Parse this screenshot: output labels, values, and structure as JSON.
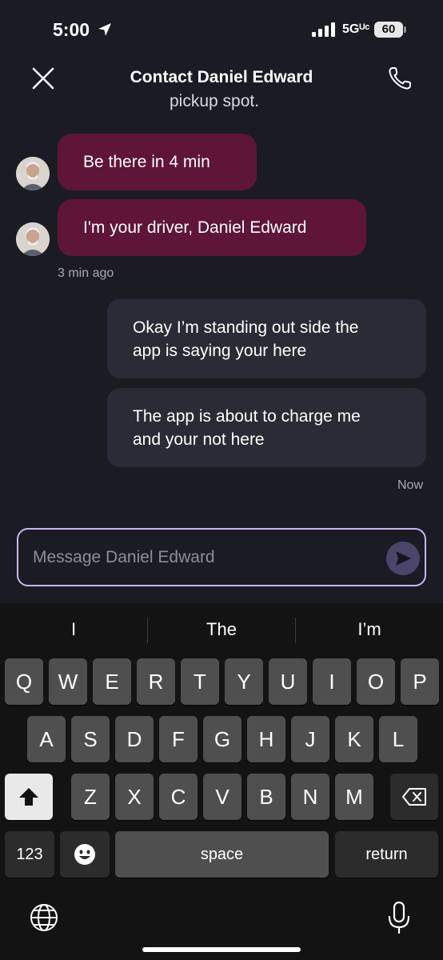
{
  "status_bar": {
    "time": "5:00",
    "network": "5Gᵁᶜ",
    "battery": "60"
  },
  "header": {
    "title": "Contact Daniel Edward"
  },
  "chat": {
    "partial_message": "pickup spot.",
    "incoming": [
      {
        "text": "Be there in 4 min"
      },
      {
        "text": "I'm your driver, Daniel Edward"
      }
    ],
    "incoming_timestamp": "3 min ago",
    "outgoing": [
      {
        "line1": "Okay I’m standing out side the",
        "line2": "app is saying your here"
      },
      {
        "line1": "The app is about to charge me",
        "line2": "and your not here"
      }
    ],
    "outgoing_timestamp": "Now"
  },
  "composer": {
    "placeholder": "Message Daniel Edward"
  },
  "keyboard": {
    "suggestions": [
      "I",
      "The",
      "I’m"
    ],
    "row1": [
      "Q",
      "W",
      "E",
      "R",
      "T",
      "Y",
      "U",
      "I",
      "O",
      "P"
    ],
    "row2": [
      "A",
      "S",
      "D",
      "F",
      "G",
      "H",
      "J",
      "K",
      "L"
    ],
    "row3": [
      "Z",
      "X",
      "C",
      "V",
      "B",
      "N",
      "M"
    ],
    "numbers_label": "123",
    "space_label": "space",
    "return_label": "return"
  },
  "colors": {
    "background": "#1b1b24",
    "incoming_bubble": "#5e1538",
    "outgoing_bubble": "#2b2b37",
    "composer_border": "#c8b6f2",
    "send_button": "#4a4569"
  },
  "icons": {
    "close": "close-icon",
    "phone": "phone-icon",
    "send": "send-icon",
    "shift": "shift-icon",
    "backspace": "backspace-icon",
    "emoji": "emoji-icon",
    "globe": "globe-icon",
    "mic": "mic-icon"
  }
}
